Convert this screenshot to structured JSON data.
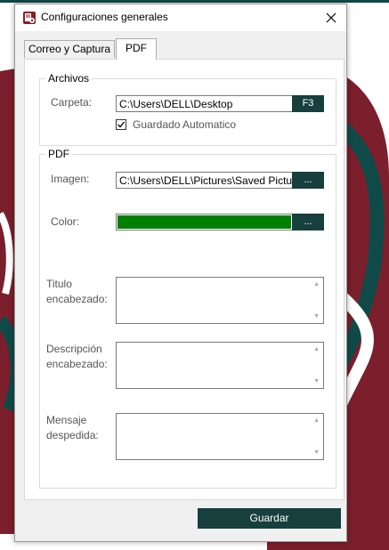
{
  "window": {
    "title": "Configuraciones generales",
    "close_icon": "close-icon",
    "app_icon": "document-settings-icon"
  },
  "tabs": [
    {
      "label": "Correo y Captura",
      "active": false
    },
    {
      "label": "PDF",
      "active": true
    }
  ],
  "archivos": {
    "group_label": "Archivos",
    "carpeta_label": "Carpeta:",
    "carpeta_value": "C:\\Users\\DELL\\Desktop",
    "carpeta_button": "F3",
    "autosave_label": "Guardado Automatico",
    "autosave_checked": true
  },
  "pdf": {
    "group_label": "PDF",
    "imagen_label": "Imagen:",
    "imagen_value": "C:\\Users\\DELL\\Pictures\\Saved Pictu",
    "imagen_button": "...",
    "color_label": "Color:",
    "color_value": "#008000",
    "color_button": "...",
    "titulo_label_1": "Titulo",
    "titulo_label_2": "encabezado:",
    "descripcion_label_1": "Descripción",
    "descripcion_label_2": "encabezado:",
    "mensaje_label_1": "Mensaje",
    "mensaje_label_2": "despedida:"
  },
  "footer": {
    "save_label": "Guardar"
  },
  "colors": {
    "accent": "#163f3e",
    "background_shape": "#7a1f2b",
    "background_stroke": "#0f4a48"
  }
}
